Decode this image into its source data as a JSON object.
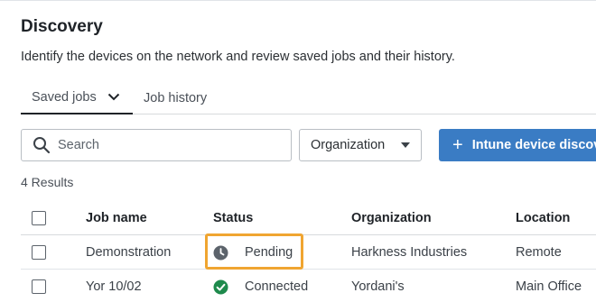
{
  "page": {
    "title": "Discovery",
    "description": "Identify the devices on the network and review saved jobs and their history."
  },
  "tabs": [
    {
      "label": "Saved jobs",
      "active": true
    },
    {
      "label": "Job history",
      "active": false
    }
  ],
  "toolbar": {
    "search_placeholder": "Search",
    "search_value": "",
    "organization_select": "Organization",
    "primary_button": "Intune device discov"
  },
  "results_text": "4 Results",
  "table": {
    "columns": [
      "Job name",
      "Status",
      "Organization",
      "Location"
    ],
    "rows": [
      {
        "job_name": "Demonstration",
        "status": "Pending",
        "status_icon": "clock-icon",
        "organization": "Harkness Industries",
        "location": "Remote"
      },
      {
        "job_name": "Yor 10/02",
        "status": "Connected",
        "status_icon": "check-circle-icon",
        "organization": "Yordani's",
        "location": "Main Office"
      }
    ]
  },
  "colors": {
    "accent": "#3a7cc4",
    "highlight": "#f0a531",
    "success": "#1e8a4c",
    "pending": "#5c636b"
  }
}
